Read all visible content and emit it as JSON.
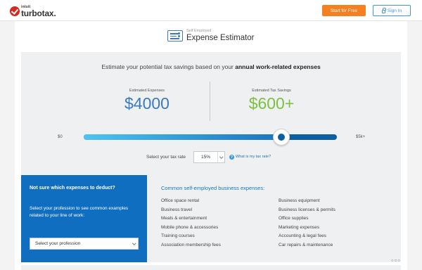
{
  "header": {
    "logo_intuit": "intuit",
    "logo_name": "turbotax.",
    "start_label": "Start for Free",
    "signin_label": "Sign In"
  },
  "title": {
    "sub": "Self Employed",
    "main": "Expense Estimator"
  },
  "estimator": {
    "heading_plain": "Estimate your potential tax savings based on your ",
    "heading_bold": "annual work-related expenses",
    "expenses_label": "Estimated Expenses",
    "expenses_value": "$4000",
    "savings_label": "Estimated Tax Savings",
    "savings_value": "$600+",
    "slider_min": "$0",
    "slider_max": "$5k+",
    "slider_fraction": 0.78,
    "rate_label": "Select your tax rate",
    "rate_value": "15%",
    "help_symbol": "?",
    "help_link": "What is my tax rate?"
  },
  "profession": {
    "title": "Not sure which expenses to deduct?",
    "description": "Select your profession to see common examples related to your line of work:",
    "select_value": "Select your profession"
  },
  "expenses": {
    "title": "Common self-employed business expenses:",
    "col1": [
      "Office space rental",
      "Business travel",
      "Meals & entertainment",
      "Mobile phone & accessories",
      "Training courses",
      "Association membership fees"
    ],
    "col2": [
      "Business equipment",
      "Business licenses & permits",
      "Office supplies",
      "Marketing expenses",
      "Accounting & legal fees",
      "Car repairs & maintenance"
    ]
  },
  "colors": {
    "brand_red": "#d52b1e",
    "cta_orange": "#f58021",
    "accent_blue": "#1a74bb",
    "savings_green": "#7ac143"
  }
}
